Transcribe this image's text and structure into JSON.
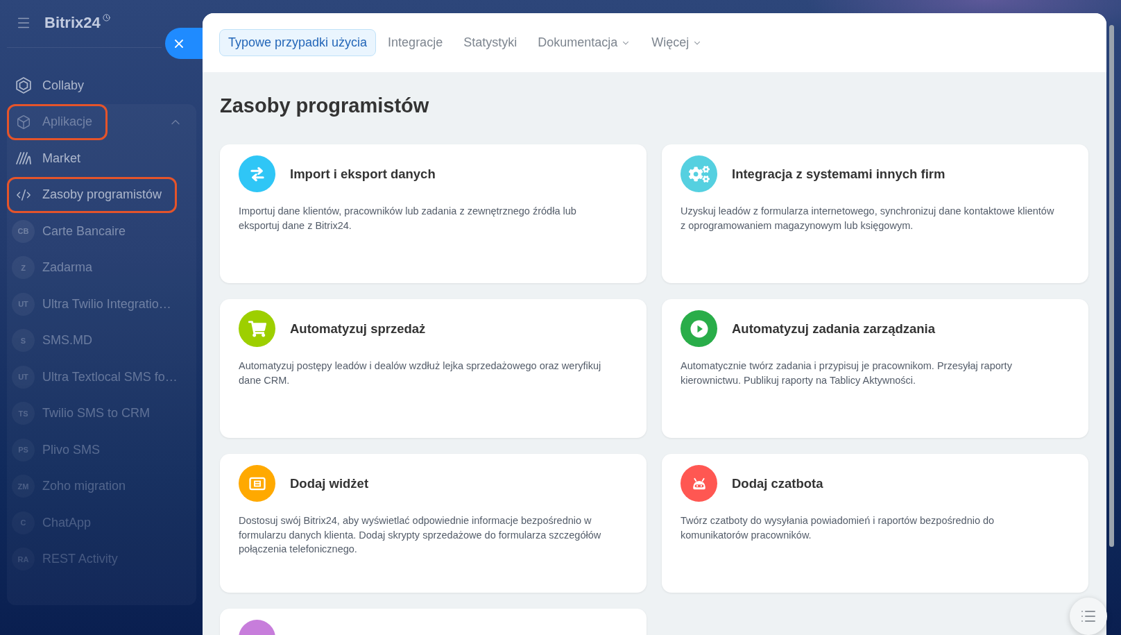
{
  "sidebar": {
    "logo": "Bitrix24",
    "items": [
      {
        "kind": "icon",
        "label": "Collaby",
        "highlighted": false
      },
      {
        "kind": "icon",
        "label": "Aplikacje",
        "highlighted": true,
        "expanded": true,
        "children": [
          {
            "kind": "icon",
            "label": "Market",
            "highlighted": false
          },
          {
            "kind": "icon",
            "label": "Zasoby programistów",
            "highlighted": true
          },
          {
            "kind": "app",
            "initials": "CB",
            "label": "Carte Bancaire",
            "highlighted": false
          },
          {
            "kind": "app",
            "initials": "Z",
            "label": "Zadarma",
            "highlighted": false
          },
          {
            "kind": "app",
            "initials": "UT",
            "label": "Ultra Twilio Integratio…",
            "highlighted": false
          },
          {
            "kind": "app",
            "initials": "S",
            "label": "SMS.MD",
            "highlighted": false
          },
          {
            "kind": "app",
            "initials": "UT",
            "label": "Ultra Textlocal SMS fo…",
            "highlighted": false
          },
          {
            "kind": "app",
            "initials": "TS",
            "label": "Twilio SMS to CRM",
            "highlighted": false
          },
          {
            "kind": "app",
            "initials": "PS",
            "label": "Plivo SMS",
            "highlighted": false
          },
          {
            "kind": "app",
            "initials": "ZM",
            "label": "Zoho migration",
            "highlighted": false
          },
          {
            "kind": "app",
            "initials": "C",
            "label": "ChatApp",
            "highlighted": false
          },
          {
            "kind": "app",
            "initials": "RA",
            "label": "REST Activity",
            "highlighted": false
          }
        ]
      }
    ]
  },
  "tabs": [
    {
      "label": "Typowe przypadki użycia",
      "selected": true,
      "dropdown": false
    },
    {
      "label": "Integracje",
      "selected": false,
      "dropdown": false
    },
    {
      "label": "Statystyki",
      "selected": false,
      "dropdown": false
    },
    {
      "label": "Dokumentacja",
      "selected": false,
      "dropdown": true
    },
    {
      "label": "Więcej",
      "selected": false,
      "dropdown": true
    }
  ],
  "page_title": "Zasoby programistów",
  "cards": [
    {
      "color": "#2fc6f6",
      "title": "Import i eksport danych",
      "description": "Importuj dane klientów, pracowników lub zadania z zewnętrznego źródła lub eksportuj dane z Bitrix24."
    },
    {
      "color": "#55d0e0",
      "title": "Integracja z systemami innych firm",
      "description": "Uzyskuj leadów z formularza internetowego, synchronizuj dane kontaktowe klientów z oprogramowaniem magazynowym lub księgowym."
    },
    {
      "color": "#9dcf00",
      "title": "Automatyzuj sprzedaż",
      "description": "Automatyzuj postępy leadów i dealów wzdłuż lejka sprzedażowego oraz weryfikuj dane CRM."
    },
    {
      "color": "#29ad49",
      "title": "Automatyzuj zadania zarządzania",
      "description": "Automatycznie twórz zadania i przypisuj je pracownikom. Przesyłaj raporty kierownictwu. Publikuj raporty na Tablicy Aktywności."
    },
    {
      "color": "#ffa900",
      "title": "Dodaj widżet",
      "description": "Dostosuj swój Bitrix24, aby wyświetlać odpowiednie informacje bezpośrednio w formularzu danych klienta. Dodaj skrypty sprzedażowe do formularza szczegółów połączenia telefonicznego."
    },
    {
      "color": "#ff5752",
      "title": "Dodaj czatbota",
      "description": "Twórz czatboty do wysyłania powiadomień i raportów bezpośrednio do komunikatorów pracowników."
    },
    {
      "color": "#c77ddb"
    }
  ]
}
